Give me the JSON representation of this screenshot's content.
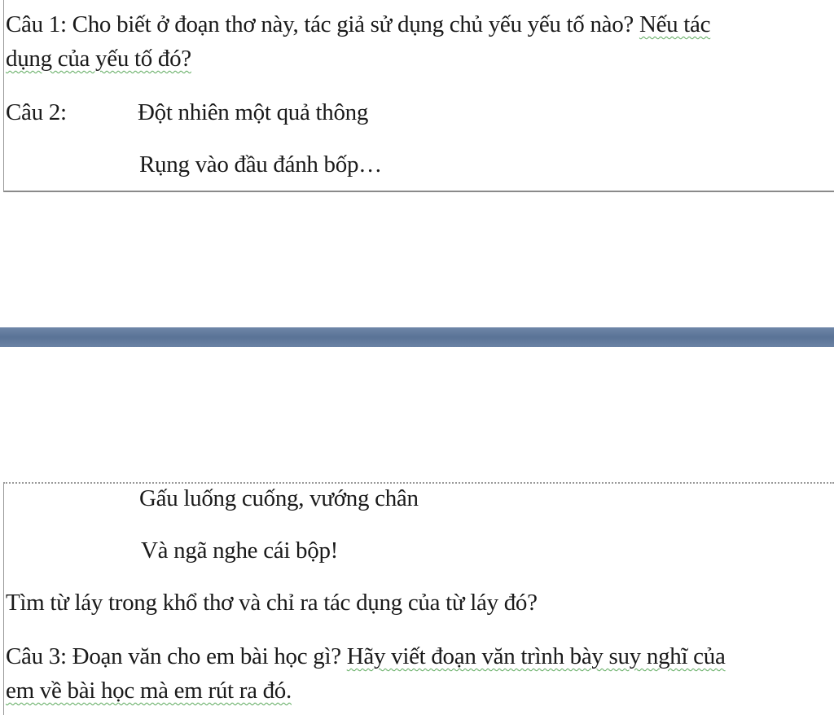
{
  "question1": {
    "line1_main": "Câu 1: Cho biết ở đoạn thơ này, tác giả sử dụng chủ yếu yếu tố nào? ",
    "line1_marked": "Nếu tác",
    "line2_marked": "dụng của yếu tố đó?"
  },
  "question2": {
    "label": "Câu 2:",
    "verse1": "Đột nhiên một quả thông",
    "verse2": "Rụng vào đầu đánh bốp…",
    "verse3": "Gấu luống cuống, vướng chân",
    "verse4": "Và ngã nghe cái bộp!",
    "prompt": "Tìm từ láy trong khổ thơ và chỉ ra tác dụng của từ láy đó?"
  },
  "question3": {
    "line1_main": "Câu 3: Đoạn văn cho em bài học gì? ",
    "line1_marked": "Hãy viết đoạn văn trình bày suy nghĩ của",
    "line2_marked": "em về bài học mà em rút ra đó."
  },
  "colors": {
    "page_separator": "#5a7396",
    "grammar_squiggle": "#5aa85a",
    "text": "#1a1a1a"
  }
}
